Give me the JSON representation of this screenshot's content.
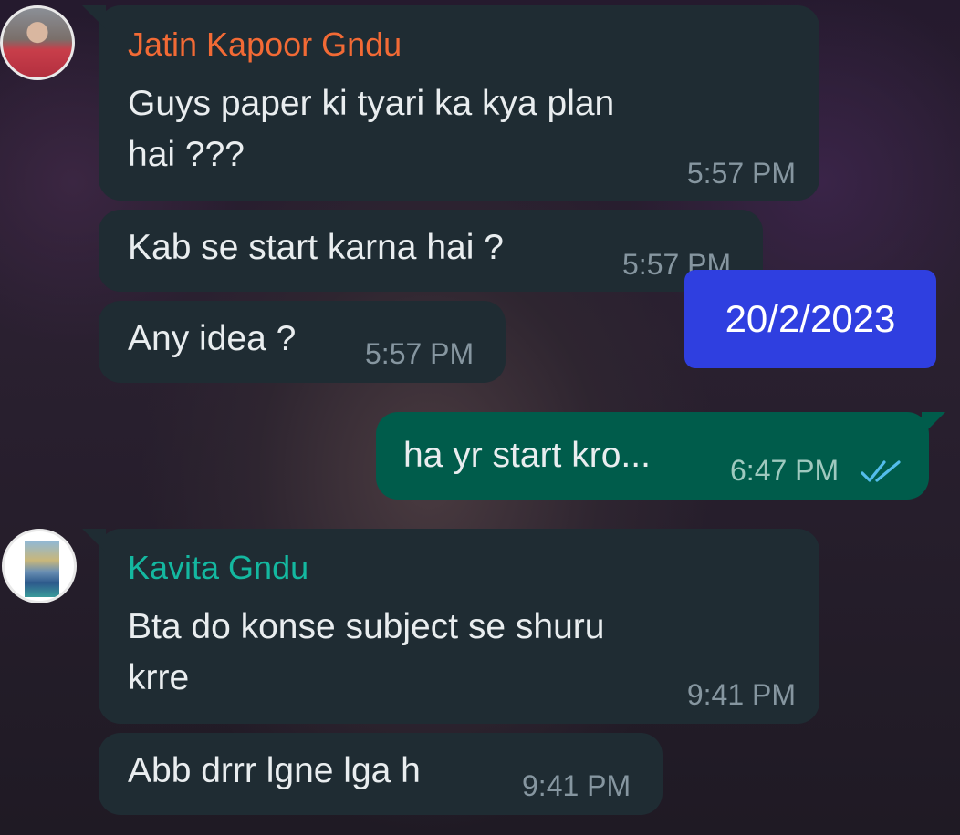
{
  "messages": [
    {
      "sender": "Jatin Kapoor Gndu",
      "sender_color": "#f26a35",
      "text_line1": "Guys paper ki tyari ka kya plan",
      "text_line2": "hai ???",
      "time": "5:57 PM"
    },
    {
      "text": "Kab se start karna hai ?",
      "time": "5:57 PM"
    },
    {
      "text": "Any idea ?",
      "time": "5:57 PM"
    },
    {
      "text": "ha yr start kro...",
      "time": "6:47 PM",
      "status": "read",
      "tick_color": "#53bdeb"
    },
    {
      "sender": "Kavita Gndu",
      "sender_color": "#14b8a0",
      "text_line1": "Bta do konse subject se shuru",
      "text_line2": "krre",
      "time": "9:41 PM"
    },
    {
      "text": "Abb drrr lgne lga h",
      "time": "9:41 PM"
    }
  ],
  "date_badge": "20/2/2023",
  "colors": {
    "incoming_bubble": "#1f2c33",
    "outgoing_bubble": "#005c4b",
    "date_badge_bg": "#2f3fe0"
  }
}
